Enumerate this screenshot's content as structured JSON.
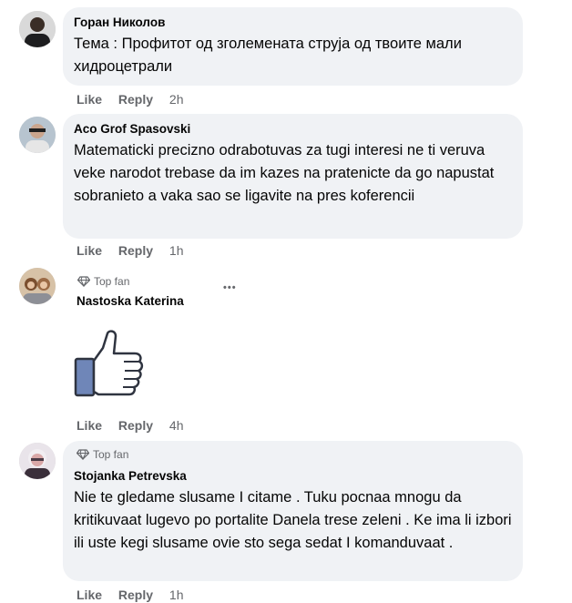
{
  "comments": [
    {
      "author": "Горан Николов",
      "text": "Тема : Профитот од зголемената струја од твоите мали хидроцетрали",
      "like": "Like",
      "reply": "Reply",
      "time": "2h"
    },
    {
      "author": "Aco Grof Spasovski",
      "text": "Matematicki precizno odrabotuvas za tugi interesi ne ti veruva veke narodot trebase da im kazes na pratenicte da go napustat sobranieto a vaka sao se ligavite na pres koferencii",
      "like": "Like",
      "reply": "Reply",
      "time": "1h"
    },
    {
      "badge": "Top fan",
      "author": "Nastoska Katerina",
      "more": "•••",
      "like": "Like",
      "reply": "Reply",
      "time": "4h"
    },
    {
      "badge": "Top fan",
      "author": "Stojanka Petrevska",
      "text": "Nie te gledame slusame I citame . Tuku pocnaa mnogu da kritikuvaat lugevo po portalite Danela trese zeleni . Ke ima li izbori ili uste kegi slusame ovie sto sega sedat I komanduvaat .",
      "like": "Like",
      "reply": "Reply",
      "time": "1h"
    }
  ],
  "colors": {
    "bubble": "#f0f2f5",
    "meta_text": "#65676b",
    "thumb_fill": "#6f86b8",
    "thumb_outline": "#2f3440"
  },
  "icons": [
    "diamond-icon",
    "thumbs-up-sticker",
    "more-options-icon"
  ]
}
